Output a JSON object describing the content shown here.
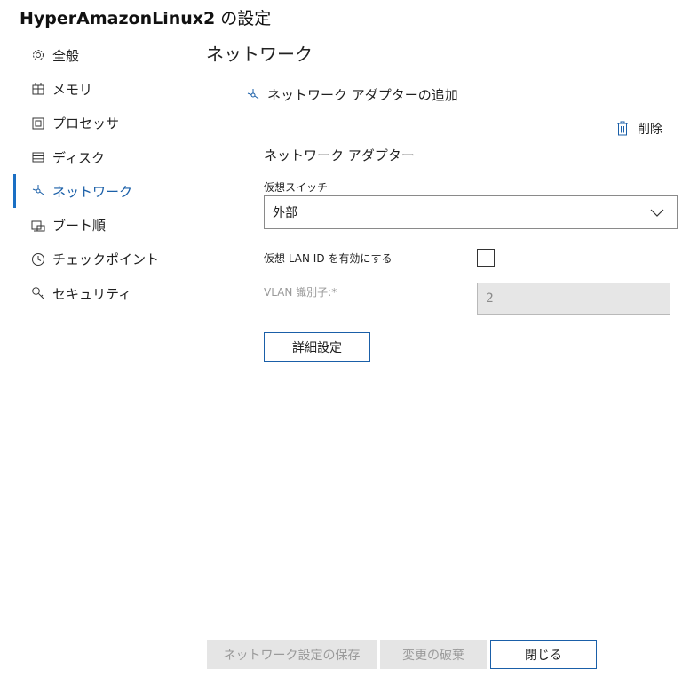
{
  "window": {
    "vm_name": "HyperAmazonLinux2",
    "title_suffix": " の設定"
  },
  "nav": {
    "items": [
      {
        "label": "全般",
        "icon": "gear-icon"
      },
      {
        "label": "メモリ",
        "icon": "memory-icon"
      },
      {
        "label": "プロセッサ",
        "icon": "processor-icon"
      },
      {
        "label": "ディスク",
        "icon": "disk-icon"
      },
      {
        "label": "ネットワーク",
        "icon": "network-icon",
        "active": true
      },
      {
        "label": "ブート順",
        "icon": "boot-order-icon"
      },
      {
        "label": "チェックポイント",
        "icon": "clock-icon"
      },
      {
        "label": "セキュリティ",
        "icon": "key-icon"
      }
    ]
  },
  "main": {
    "section_title": "ネットワーク",
    "add_adapter_label": "ネットワーク アダプターの追加",
    "delete_label": "削除",
    "adapter_heading": "ネットワーク アダプター",
    "virtual_switch": {
      "label": "仮想スイッチ",
      "selected": "外部"
    },
    "vlan_enable": {
      "label": "仮想 LAN ID を有効にする",
      "checked": false
    },
    "vlan_id": {
      "label": "VLAN 識別子:*",
      "value": "2"
    },
    "advanced_button": "詳細設定"
  },
  "footer": {
    "save_label": "ネットワーク設定の保存",
    "discard_label": "変更の破棄",
    "close_label": "閉じる"
  },
  "colors": {
    "accent": "#1a5fa8",
    "disabled_bg": "#e5e5e5",
    "disabled_text": "#9a9a9a"
  }
}
